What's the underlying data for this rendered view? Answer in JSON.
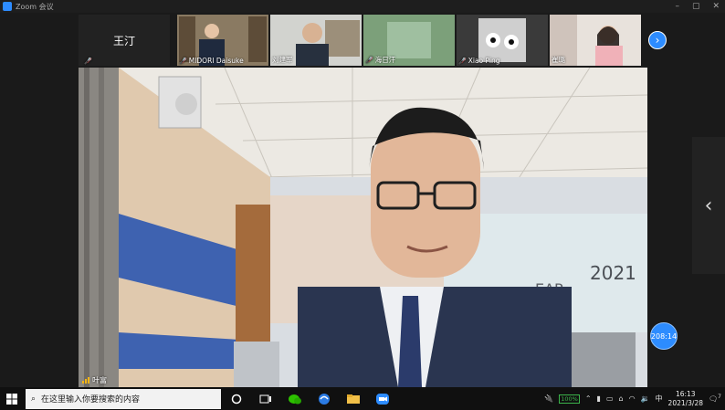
{
  "window": {
    "title": "Zoom 会议"
  },
  "participants": [
    {
      "name": "王汀",
      "mic_muted": true,
      "video": false
    },
    {
      "name": "MIDORI Daisuke",
      "mic_muted": true,
      "video": true
    },
    {
      "name": "刘建军",
      "mic_muted": false,
      "video": true
    },
    {
      "name": "海日汗",
      "mic_muted": true,
      "video": true
    },
    {
      "name": "Xiao Ping",
      "mic_muted": true,
      "video": true
    },
    {
      "name": "崔璐",
      "mic_muted": false,
      "video": true
    }
  ],
  "main_video": {
    "speaker_name": "叶富"
  },
  "meeting_timer": "208:14",
  "taskbar": {
    "search_placeholder": "在这里输入你要搜索的内容",
    "tray_badge": "100%",
    "ime": "中",
    "time": "16:13",
    "date": "2021/3/28",
    "notification_count": "7"
  }
}
